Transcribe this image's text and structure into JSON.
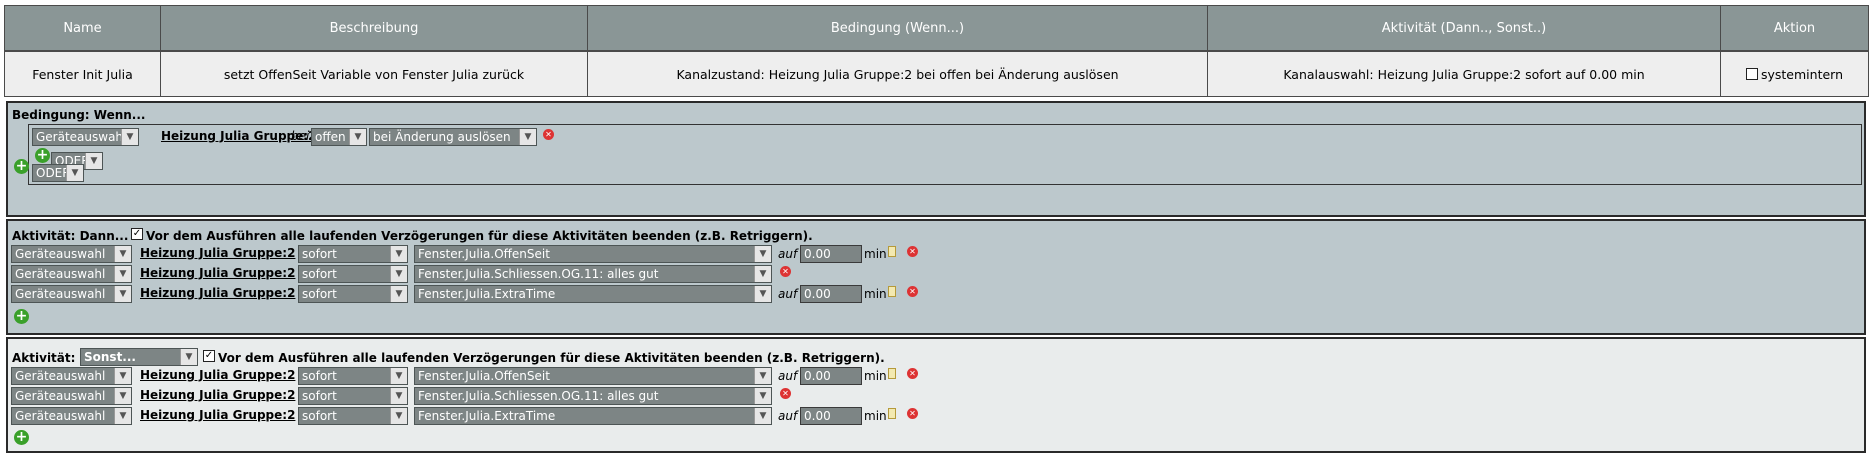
{
  "header": {
    "columns": [
      "Name",
      "Beschreibung",
      "Bedingung (Wenn...)",
      "Aktivität (Dann.., Sonst..)",
      "Aktion"
    ]
  },
  "row": {
    "name": "Fenster Init Julia",
    "beschreibung": "setzt OffenSeit Variable von Fenster Julia zurück",
    "bedingung": "Kanalzustand: Heizung Julia Gruppe:2 bei offen bei Änderung auslösen",
    "aktivitaet": "Kanalauswahl: Heizung Julia Gruppe:2 sofort auf 0.00 min",
    "aktion_label": "systemintern",
    "aktion_checked": false
  },
  "condition": {
    "title": "Bedingung: Wenn...",
    "device_select": "Geräteauswahl",
    "device_link": "Heizung Julia Gruppe:2",
    "bei": "bei",
    "state_select": "offen",
    "trigger_select": "bei Änderung auslösen",
    "inner_or": "ODER",
    "outer_or": "ODER"
  },
  "then": {
    "title": "Aktivität: Dann...",
    "retrigger_text": "Vor dem Ausführen alle laufenden Verzögerungen für diese Aktivitäten beenden (z.B. Retriggern).",
    "retrigger_checked": true,
    "rows": [
      {
        "select": "Geräteauswahl",
        "link": "Heizung Julia Gruppe:2",
        "timing": "sofort",
        "target": "Fenster.Julia.OffenSeit",
        "auf": "auf",
        "value": "0.00",
        "unit": "min"
      },
      {
        "select": "Geräteauswahl",
        "link": "Heizung Julia Gruppe:2",
        "timing": "sofort",
        "target": "Fenster.Julia.Schliessen.OG.11: alles gut"
      },
      {
        "select": "Geräteauswahl",
        "link": "Heizung Julia Gruppe:2",
        "timing": "sofort",
        "target": "Fenster.Julia.ExtraTime",
        "auf": "auf",
        "value": "0.00",
        "unit": "min"
      }
    ]
  },
  "else": {
    "title": "Aktivität:",
    "mode_select": "Sonst...",
    "retrigger_text": "Vor dem Ausführen alle laufenden Verzögerungen für diese Aktivitäten beenden (z.B. Retriggern).",
    "retrigger_checked": true,
    "rows": [
      {
        "select": "Geräteauswahl",
        "link": "Heizung Julia Gruppe:2",
        "timing": "sofort",
        "target": "Fenster.Julia.OffenSeit",
        "auf": "auf",
        "value": "0.00",
        "unit": "min"
      },
      {
        "select": "Geräteauswahl",
        "link": "Heizung Julia Gruppe:2",
        "timing": "sofort",
        "target": "Fenster.Julia.Schliessen.OG.11: alles gut"
      },
      {
        "select": "Geräteauswahl",
        "link": "Heizung Julia Gruppe:2",
        "timing": "sofort",
        "target": "Fenster.Julia.ExtraTime",
        "auf": "auf",
        "value": "0.00",
        "unit": "min"
      }
    ]
  },
  "icons": {
    "add": "add-icon",
    "delete": "delete-icon",
    "clipboard": "clipboard-icon",
    "dropdown": "chevron-down-icon"
  },
  "colors": {
    "header_bg": "#8a9696",
    "section_bg": "#bcc8cc",
    "select_bg": "#7d8585",
    "add_green": "#3aa02a",
    "delete_red": "#dd3333"
  }
}
